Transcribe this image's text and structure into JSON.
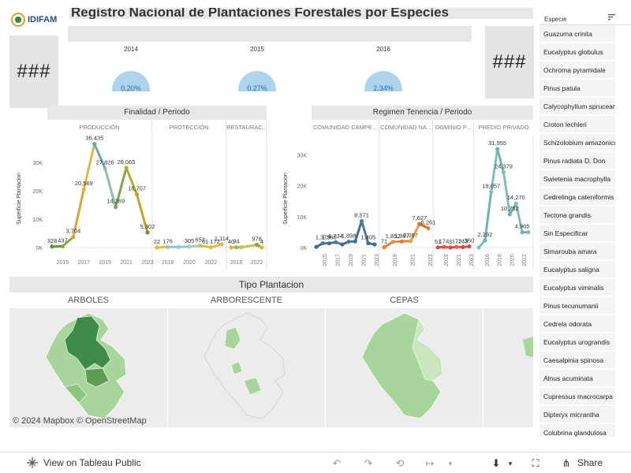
{
  "logo": {
    "text": "IDIFAM"
  },
  "dashboard": {
    "title": "Registro Nacional de Plantaciones Forestales por Especies"
  },
  "kpis": {
    "left": "###",
    "right": "###"
  },
  "years": [
    {
      "label": "2014",
      "pct": "0.20%"
    },
    {
      "label": "2015",
      "pct": "0.27%"
    },
    {
      "label": "2016",
      "pct": "2.34%"
    }
  ],
  "chart_finalidad": {
    "title": "Finalidad / Periodo",
    "groups": [
      "PRODUCCIÓN",
      "PROTECCIÓN",
      "RESTAURAC.."
    ],
    "ylabel": "Superficie Plantacion",
    "yticks": [
      "0K",
      "10K",
      "20K",
      "30K"
    ],
    "xticks": [
      "2015",
      "2017",
      "2019",
      "2021",
      "2023",
      "2018",
      "2020",
      "2022",
      "2018",
      "2022"
    ]
  },
  "chart_tenencia": {
    "title": "Regimen Tenencia  / Periodo",
    "groups": [
      "COMUNIDAD CAMPE...",
      "COMUNIDAD NA...",
      "DOMINIO P...",
      "PREDIO PRIVADO"
    ],
    "ylabel": "Superficie Plantacion",
    "yticks": [
      "0K",
      "10K",
      "20K",
      "30K"
    ],
    "xticks": [
      "2015",
      "2017",
      "2019",
      "2021",
      "2023",
      "2019",
      "2021",
      "2023",
      "2019",
      "2021",
      "2023",
      "2016",
      "2018",
      "2020",
      "2022"
    ]
  },
  "chart_data": [
    {
      "type": "line",
      "title": "Finalidad / Periodo",
      "ylabel": "Superficie Plantacion",
      "ylim": [
        0,
        38000
      ],
      "series": [
        {
          "name": "PRODUCCIÓN",
          "x": [
            2014,
            2015,
            2016,
            2017,
            2018,
            2019,
            2020,
            2021,
            2022,
            2023
          ],
          "values": [
            328,
            437,
            3704,
            20569,
            36435,
            27826,
            14269,
            28065,
            18707,
            5302
          ],
          "labels": [
            "328",
            "437",
            "3,704",
            "20,569",
            "36,435",
            "27,826",
            "14,269",
            "28,065",
            "18,707",
            "5,302"
          ]
        },
        {
          "name": "PROTECCIÓN",
          "x": [
            2017,
            2018,
            2019,
            2020,
            2021,
            2022,
            2023
          ],
          "values": [
            22,
            176,
            200,
            305,
            653,
            61,
            1114
          ],
          "labels": [
            "22",
            "176",
            "",
            "305",
            "653",
            "61 172",
            "1,114"
          ]
        },
        {
          "name": "RESTAURAC..",
          "x": [
            2017,
            2018,
            2019,
            2022,
            2023
          ],
          "values": [
            40,
            94,
            100,
            978,
            4
          ],
          "labels": [
            "40",
            "94",
            "",
            "978",
            "4"
          ]
        }
      ]
    },
    {
      "type": "line",
      "title": "Regimen Tenencia  / Periodo",
      "ylabel": "Superficie Plantacion",
      "ylim": [
        0,
        35000
      ],
      "series": [
        {
          "name": "COMUNIDAD CAMPE...",
          "x": [
            2014,
            2015,
            2016,
            2017,
            2018,
            2019,
            2020,
            2021,
            2022,
            2023
          ],
          "values": [
            200,
            1375,
            1360,
            1734,
            1000,
            1898,
            2000,
            8571,
            1405,
            1000
          ],
          "labels": [
            "",
            "1,375",
            "1,360",
            "1,734",
            "",
            "1,898",
            "",
            "8,571",
            "1,405",
            ""
          ]
        },
        {
          "name": "COMUNIDAD NA...",
          "x": [
            2018,
            2019,
            2020,
            2021,
            2022,
            2023
          ],
          "values": [
            71,
            1852,
            1967,
            2097,
            7627,
            6261
          ],
          "labels": [
            "71",
            "1,852",
            "1,967",
            "2,097",
            "7,627",
            "6,261"
          ]
        },
        {
          "name": "DOMINIO P...",
          "x": [
            2018,
            2019,
            2020,
            2021,
            2022,
            2023
          ],
          "values": [
            51,
            174,
            3,
            172,
            143,
            360
          ],
          "labels": [
            "51",
            "174",
            "3",
            "172",
            "143",
            "360"
          ]
        },
        {
          "name": "PREDIO PRIVADO",
          "x": [
            2015,
            2016,
            2017,
            2018,
            2019,
            2020,
            2021,
            2022,
            2023
          ],
          "values": [
            0,
            2292,
            18057,
            31955,
            24379,
            10752,
            14270,
            4965,
            4965
          ],
          "labels": [
            "",
            "2,292",
            "18,057",
            "31,955",
            "24,379",
            "10,752",
            "14,270",
            "4,965",
            ""
          ]
        }
      ]
    }
  ],
  "tipo_plantacion": {
    "title": "Tipo Plantacion",
    "columns": [
      "ARBOLES",
      "ARBORESCENTE",
      "CEPAS"
    ],
    "attribution": "© 2024 Mapbox  © OpenStreetMap"
  },
  "species_list": {
    "header": "Especie",
    "items": [
      "Guazuma crinita",
      "Eucalyptus globulus",
      "Ochroma pyramidale",
      "Pinus patula",
      "Calycophyllum spruceanum",
      "Croton lechleri",
      "Schizolobium amazonicum",
      "Pinus radiata D. Don",
      "Swietenia macrophylla",
      "Cedrelinga cateniformis",
      "Tectona grandis",
      "Sin Especificar",
      "Simarouba amara",
      "Eucalyptus saligna",
      "Eucalyptus viminalis",
      "Pinus tecunumanii",
      "Cedrela odorata",
      "Eucalyptus urograndis",
      "Caesalpinia spinosa",
      "Alnus acuminata",
      "Cupressus macrocarpa",
      "Dipteryx micrantha",
      "Colubrina glandulosa"
    ]
  },
  "toolbar": {
    "view_label": "View on Tableau Public",
    "share_label": "Share"
  },
  "colors": {
    "panel": "#e8e8e8",
    "bubble": "#aed4ec",
    "map_dark": "#3f8c4a",
    "map_light": "#a8d59b"
  }
}
